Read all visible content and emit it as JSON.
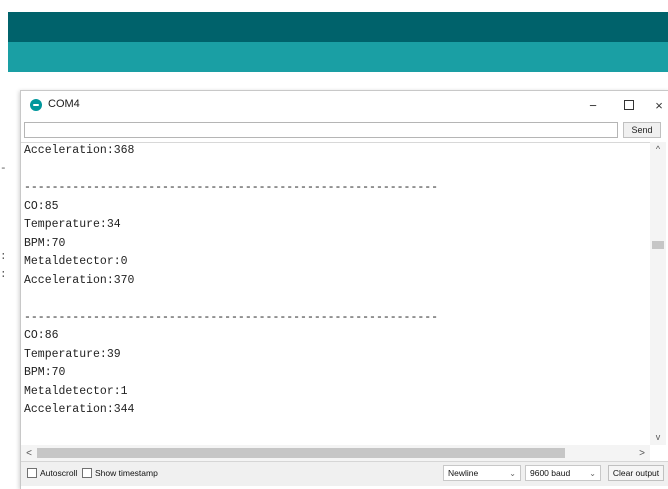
{
  "colors": {
    "ide_dark": "#00626b",
    "ide_teal": "#1a9fa4",
    "arduino_icon": "#00979c"
  },
  "window": {
    "title": "COM4",
    "app_icon": "arduino-logo-icon",
    "controls": {
      "minimize": "−",
      "maximize": "maximize-icon",
      "close": "×"
    }
  },
  "send": {
    "input_value": "",
    "button_label": "Send"
  },
  "output": {
    "lines": [
      "Acceleration:368",
      "",
      "------------------------------------------------------------",
      "CO:85",
      "Temperature:34",
      "BPM:70",
      "Metaldetector:0",
      "Acceleration:370",
      "",
      "------------------------------------------------------------",
      "CO:86",
      "Temperature:39",
      "BPM:70",
      "Metaldetector:1",
      "Acceleration:344"
    ]
  },
  "scroll": {
    "up": "^",
    "down": "v",
    "left": "<",
    "right": ">"
  },
  "status": {
    "autoscroll_label": "Autoscroll",
    "autoscroll_checked": false,
    "timestamp_label": "Show timestamp",
    "timestamp_checked": false,
    "line_ending": "Newline",
    "baud": "9600 baud",
    "clear_label": "Clear output"
  }
}
